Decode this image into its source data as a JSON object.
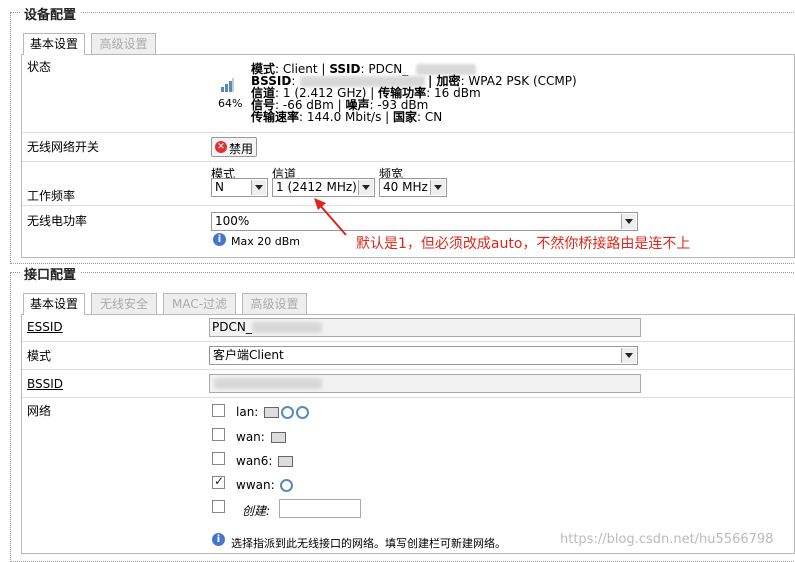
{
  "device_section": {
    "legend": "设备配置",
    "tabs": [
      {
        "label": "基本设置",
        "active": true
      },
      {
        "label": "高级设置",
        "active": false
      }
    ],
    "status": {
      "label": "状态",
      "signal_percent": "64%",
      "mode_key": "模式",
      "mode_value": ": Client |",
      "ssid_key": "SSID",
      "ssid_value": ": PDCN_",
      "bssid_key": "BSSID",
      "bssid_value": ":",
      "encryption_key": "| 加密",
      "encryption_value": ": WPA2 PSK (CCMP)",
      "channel_key": "信道",
      "channel_value": ": 1 (2.412 GHz) |",
      "txpower_key": "传输功率",
      "txpower_value": ": 16 dBm",
      "signal_key": "信号",
      "signal_value": ": -66 dBm |",
      "noise_key": "噪声",
      "noise_value": ": -93 dBm",
      "bitrate_key": "传输速率",
      "bitrate_value": ": 144.0 Mbit/s |",
      "country_key": "国家",
      "country_value": ": CN"
    },
    "wireless_switch": {
      "label": "无线网络开关",
      "button": "禁用"
    },
    "frequency": {
      "label": "工作频率",
      "mode_label": "模式",
      "mode_value": "N",
      "channel_label": "信道",
      "channel_value": "1 (2412 MHz)",
      "width_label": "频宽",
      "width_value": "40 MHz"
    },
    "txpower": {
      "label": "无线电功率",
      "value": "100%",
      "hint": "Max 20 dBm"
    },
    "annotation": "默认是1，但必须改成auto，不然你桥接路由是连不上"
  },
  "interface_section": {
    "legend": "接口配置",
    "tabs": [
      {
        "label": "基本设置",
        "active": true
      },
      {
        "label": "无线安全",
        "active": false
      },
      {
        "label": "MAC-过滤",
        "active": false
      },
      {
        "label": "高级设置",
        "active": false
      }
    ],
    "essid": {
      "label": "ESSID",
      "value": "PDCN_"
    },
    "mode": {
      "label": "模式",
      "value": "客户端Client"
    },
    "bssid": {
      "label": "BSSID",
      "value": ""
    },
    "network": {
      "label": "网络",
      "items": [
        {
          "name": "lan:",
          "checked": false
        },
        {
          "name": "wan:",
          "checked": false
        },
        {
          "name": "wan6:",
          "checked": false
        },
        {
          "name": "wwan:",
          "checked": true
        }
      ],
      "create_label": "创建:",
      "hint": "选择指派到此无线接口的网络。填写创建栏可新建网络。"
    }
  },
  "watermark": "https://blog.csdn.net/hu5566798"
}
